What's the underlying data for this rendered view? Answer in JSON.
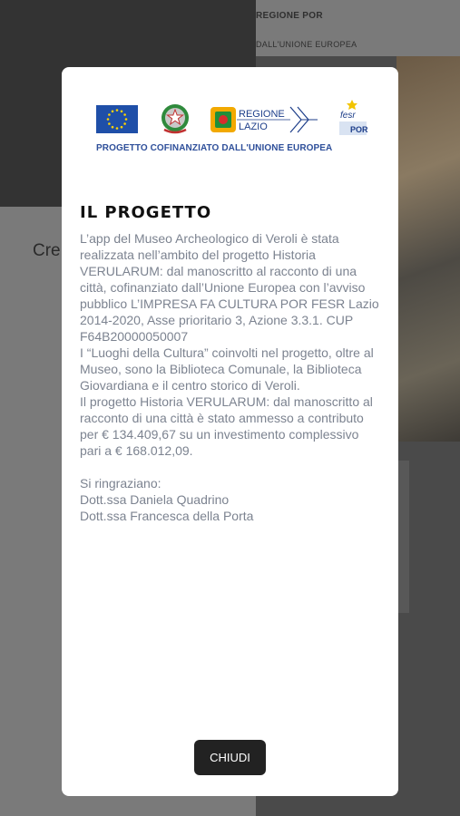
{
  "background": {
    "header_logo_line1": "REGIONE POR",
    "header_logo_line2": "DALL'UNIONE EUROPEA",
    "partial_text": "Cre"
  },
  "modal": {
    "logos": {
      "regione": "REGIONE",
      "lazio": "LAZIO",
      "fesr": "fesr",
      "por": "POR",
      "cofinanziato": "PROGETTO COFINANZIATO DALL'UNIONE EUROPEA"
    },
    "title": "IL PROGETTO",
    "paragraphs": [
      "L’app del Museo Archeologico di Veroli è stata realizzata nell’ambito del progetto Historia VERULARUM: dal manoscritto al racconto di una città, cofinanziato dall’Unione Europea con l’avviso pubblico L’IMPRESA FA CULTURA POR FESR Lazio 2014-2020, Asse prioritario 3, Azione 3.3.1. CUP F64B20000050007",
      "I “Luoghi della Cultura” coinvolti nel progetto, oltre al Museo, sono la Biblioteca Comunale, la Biblioteca Giovardiana e il centro storico di Veroli.",
      "Il progetto Historia VERULARUM: dal manoscritto al racconto di una città è stato ammesso a contributo per € 134.409,67 su un investimento complessivo pari a € 168.012,09."
    ],
    "thanks_label": "Si ringraziano:",
    "thanks": [
      "Dott.ssa Daniela Quadrino",
      "Dott.ssa Francesca della Porta"
    ],
    "close_label": "CHIUDI"
  },
  "colors": {
    "overlay": "#5a5a5a",
    "eu_blue": "#1f4fa8",
    "body_text": "#7c8390",
    "button": "#222222"
  },
  "icons": [
    "map-icon",
    "eu-flag-icon",
    "italian-emblem-icon",
    "regione-lazio-logo",
    "fesr-por-logo"
  ]
}
